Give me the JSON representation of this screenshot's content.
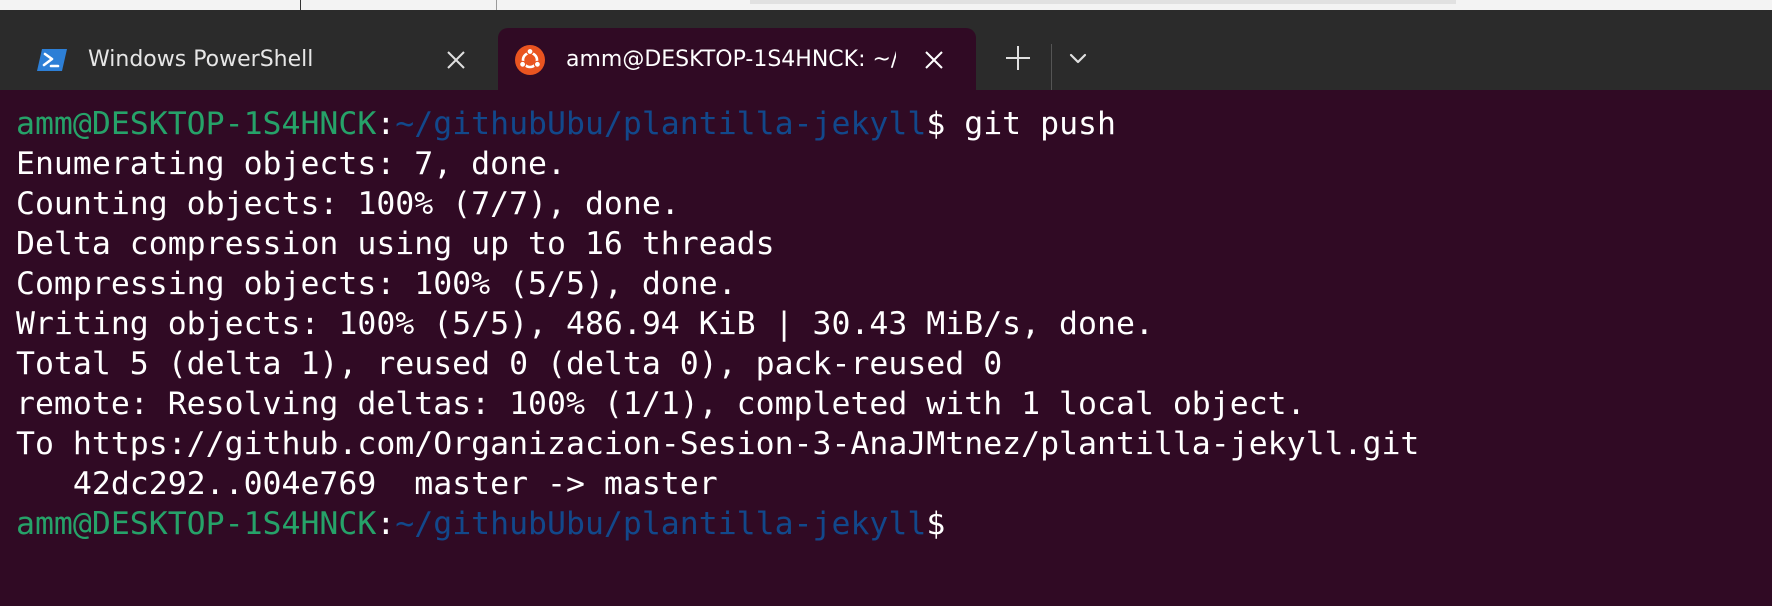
{
  "tabs": [
    {
      "label": "Windows PowerShell",
      "icon": "powershell-icon",
      "active": false
    },
    {
      "label": "amm@DESKTOP-1S4HNCK: ~/",
      "icon": "ubuntu-icon",
      "active": true
    }
  ],
  "controls": {
    "new_tab_icon": "plus-icon",
    "dropdown_icon": "chevron-down-icon",
    "close_icon": "close-icon"
  },
  "colors": {
    "terminal_background": "#300a24",
    "tabbar_background": "#2b2b2b",
    "prompt_user": "#26a269",
    "prompt_path": "#12488b",
    "text": "#ffffff",
    "powershell_blue": "#2d7fd6",
    "ubuntu_orange": "#e95420"
  },
  "terminal": {
    "prompt_user_host": "amm@DESKTOP-1S4HNCK",
    "prompt_colon": ":",
    "prompt_path": "~/githubUbu/plantilla-jekyll",
    "prompt_symbol": "$",
    "command": " git push",
    "output": [
      "Enumerating objects: 7, done.",
      "Counting objects: 100% (7/7), done.",
      "Delta compression using up to 16 threads",
      "Compressing objects: 100% (5/5), done.",
      "Writing objects: 100% (5/5), 486.94 KiB | 30.43 MiB/s, done.",
      "Total 5 (delta 1), reused 0 (delta 0), pack-reused 0",
      "remote: Resolving deltas: 100% (1/1), completed with 1 local object.",
      "To https://github.com/Organizacion-Sesion-3-AnaJMtnez/plantilla-jekyll.git",
      "   42dc292..004e769  master -> master"
    ]
  }
}
